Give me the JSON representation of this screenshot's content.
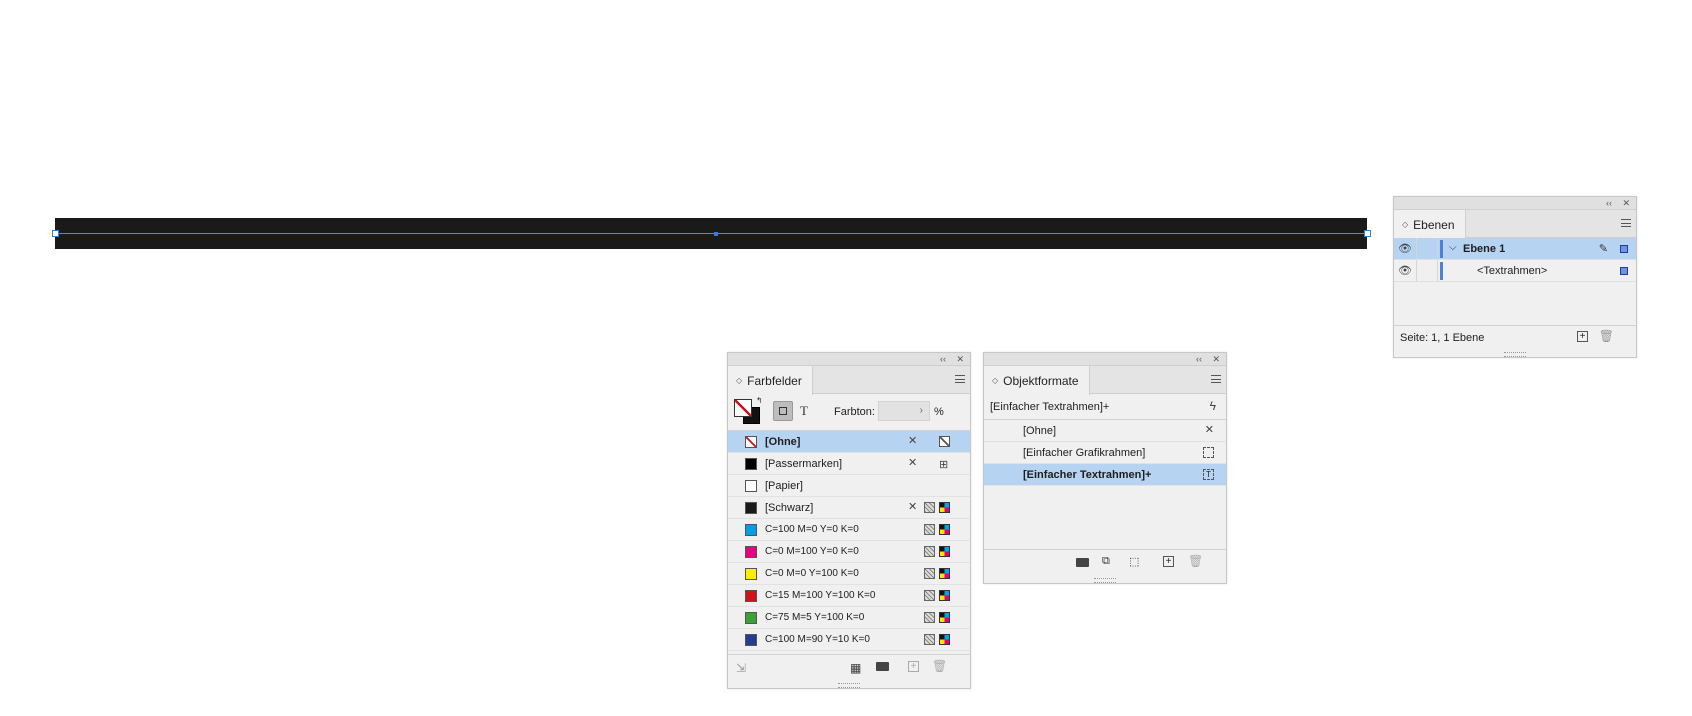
{
  "panel_controls": {
    "collapse": "‹‹",
    "close": "✕"
  },
  "ebenen": {
    "tab_label": "Ebenen",
    "layers": [
      {
        "name": "Ebene 1",
        "expanded": true,
        "selected": true
      },
      {
        "name": "<Textrahmen>",
        "selected": false
      }
    ],
    "status": "Seite: 1, 1 Ebene",
    "layer_color": "#4f7fd6"
  },
  "farbfelder": {
    "tab_label": "Farbfelder",
    "tint_label": "Farbton:",
    "tint_value": "",
    "tint_unit": "%",
    "text_toggle": "T",
    "swatches": [
      {
        "name": "[Ohne]",
        "color": "none",
        "selected": true
      },
      {
        "name": "[Passermarken]",
        "color": "#000000",
        "selected": false
      },
      {
        "name": "[Papier]",
        "color": "#ffffff",
        "selected": false
      },
      {
        "name": "[Schwarz]",
        "color": "#1a1a1a",
        "selected": false
      },
      {
        "name": "C=100 M=0 Y=0 K=0",
        "color": "#009fe3",
        "selected": false
      },
      {
        "name": "C=0 M=100 Y=0 K=0",
        "color": "#e6007e",
        "selected": false
      },
      {
        "name": "C=0 M=0 Y=100 K=0",
        "color": "#ffed00",
        "selected": false
      },
      {
        "name": "C=15 M=100 Y=100 K=0",
        "color": "#d0121a",
        "selected": false
      },
      {
        "name": "C=75 M=5 Y=100 K=0",
        "color": "#3aa137",
        "selected": false
      },
      {
        "name": "C=100 M=90 Y=10 K=0",
        "color": "#253c8f",
        "selected": false
      }
    ]
  },
  "objektformate": {
    "tab_label": "Objektformate",
    "current_style": "[Einfacher Textrahmen]+",
    "styles": [
      {
        "name": "[Ohne]",
        "selected": false
      },
      {
        "name": "[Einfacher Grafikrahmen]",
        "selected": false
      },
      {
        "name": "[Einfacher Textrahmen]+",
        "selected": true
      }
    ]
  }
}
